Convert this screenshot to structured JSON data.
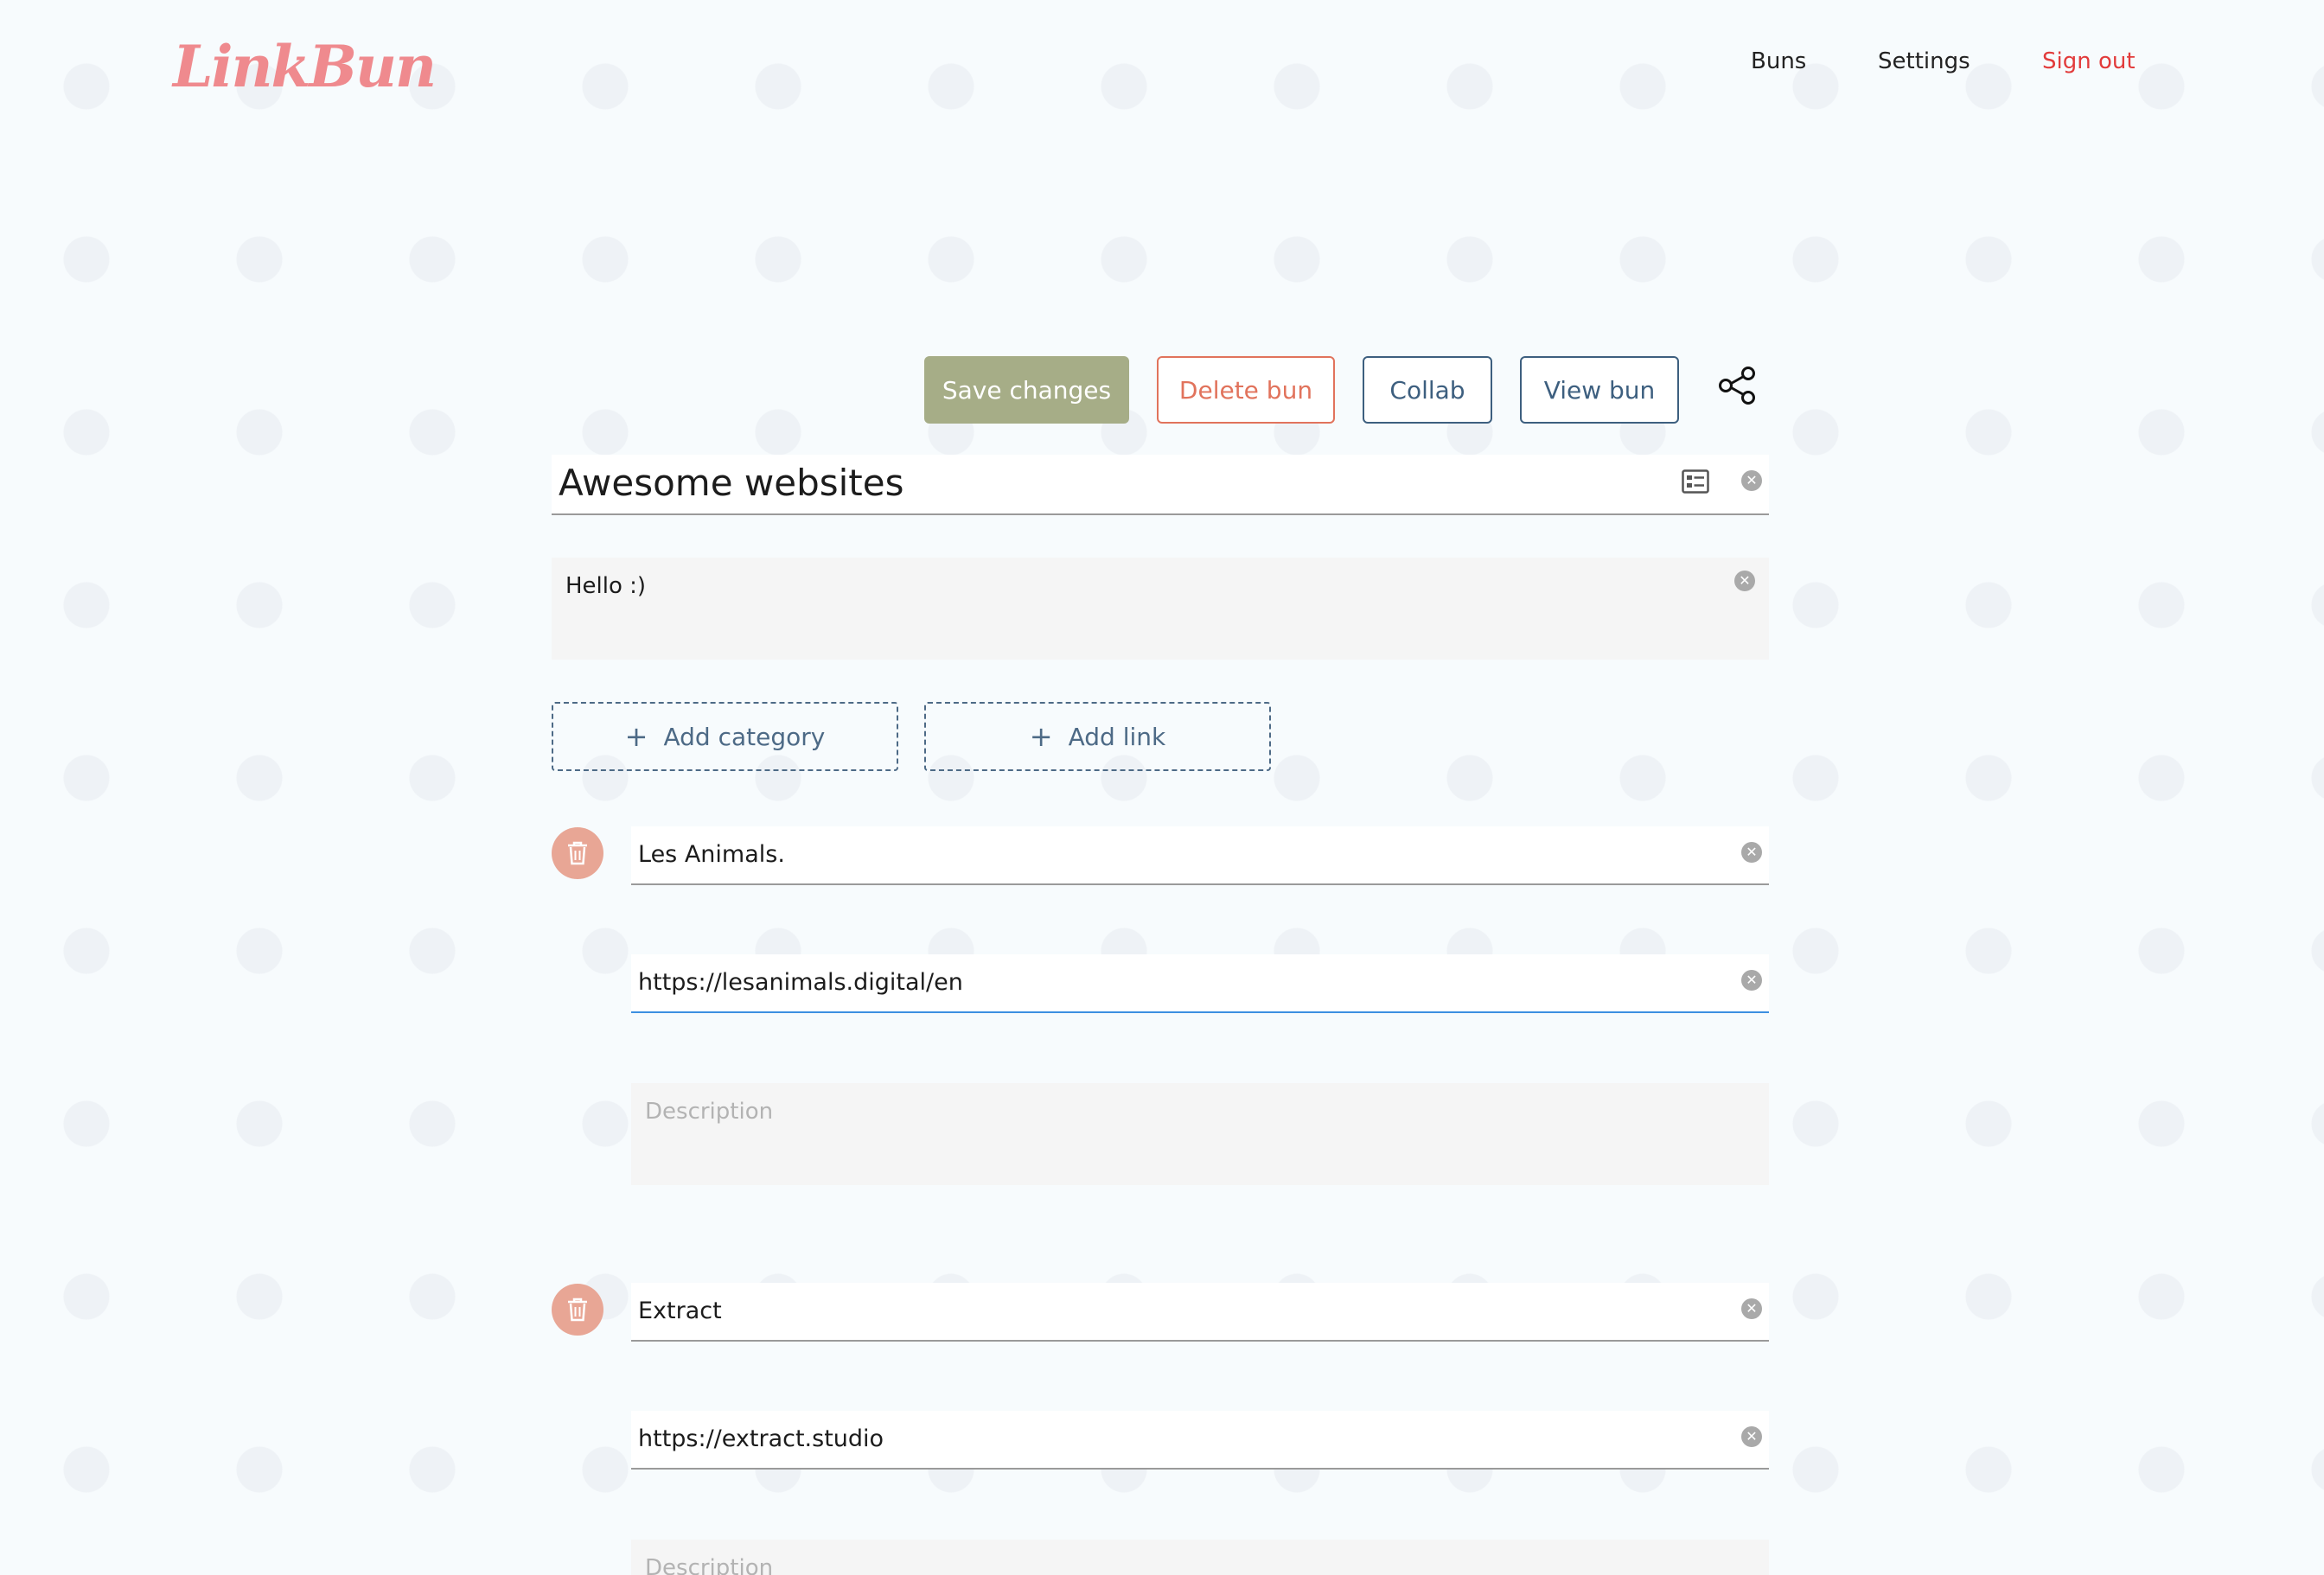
{
  "brand": {
    "logo_text": "LinkBun",
    "logo_color": "#ef8a8e"
  },
  "nav": {
    "buns": "Buns",
    "settings": "Settings",
    "sign_out": "Sign out"
  },
  "toolbar": {
    "save_label": "Save changes",
    "delete_label": "Delete bun",
    "collab_label": "Collab",
    "view_label": "View bun",
    "share_icon": "share-icon"
  },
  "bun": {
    "title": "Awesome websites",
    "description": "Hello :)"
  },
  "actions": {
    "add_category": "Add category",
    "add_link": "Add link"
  },
  "links": [
    {
      "title": "Les Animals.",
      "url": "https://lesanimals.digital/en",
      "description_placeholder": "Description"
    },
    {
      "title": "Extract",
      "url": "https://extract.studio",
      "description_placeholder": "Description"
    }
  ],
  "colors": {
    "save": "#a6ad87",
    "delete": "#e1735c",
    "outline": "#3d5f7f",
    "sign_out": "#e23b3b",
    "trash": "#e8a695",
    "focus": "#3c8fe0"
  }
}
